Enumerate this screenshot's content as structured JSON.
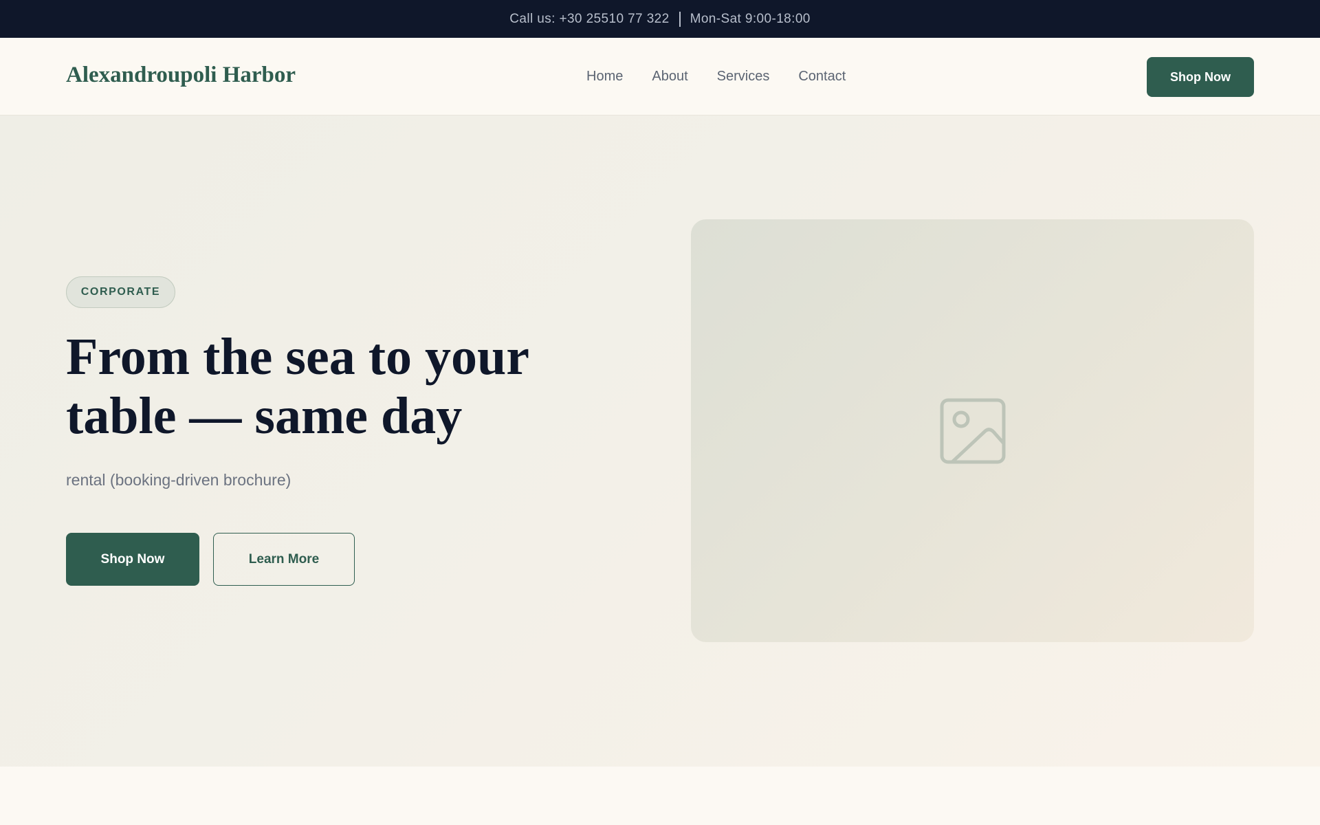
{
  "topbar": {
    "phone": "Call us: +30 25510 77 322",
    "hours": "Mon-Sat 9:00-18:00"
  },
  "header": {
    "brand": "Alexandroupoli Harbor",
    "nav": [
      {
        "label": "Home"
      },
      {
        "label": "About"
      },
      {
        "label": "Services"
      },
      {
        "label": "Contact"
      }
    ],
    "cta_label": "Shop Now"
  },
  "hero": {
    "badge": "CORPORATE",
    "title": "From the sea to your table — same day",
    "subtitle": "rental (booking-driven brochure)",
    "primary_label": "Shop Now",
    "secondary_label": "Learn More",
    "image_icon": "image-placeholder-icon"
  },
  "colors": {
    "accent": "#2f5d4f",
    "topbar_bg": "#0f172a",
    "page_bg": "#fcf9f3"
  }
}
